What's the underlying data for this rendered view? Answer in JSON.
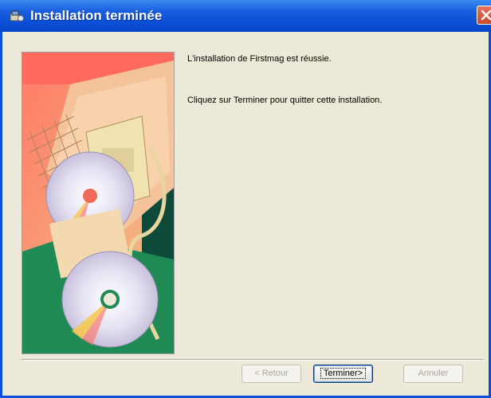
{
  "window": {
    "title": "Installation terminée"
  },
  "messages": {
    "line1": "L'installation de Firstmag est réussie.",
    "line2": "Cliquez sur Terminer pour quitter cette installation."
  },
  "buttons": {
    "back": "< Retour",
    "finish": "Terminer>",
    "cancel": "Annuler"
  },
  "colors": {
    "titlebar": "#0b4fd6",
    "dialog_bg": "#ece9d8",
    "close": "#c84a2e"
  },
  "icons": {
    "title_icon": "installer-icon",
    "close_icon": "close-icon"
  }
}
